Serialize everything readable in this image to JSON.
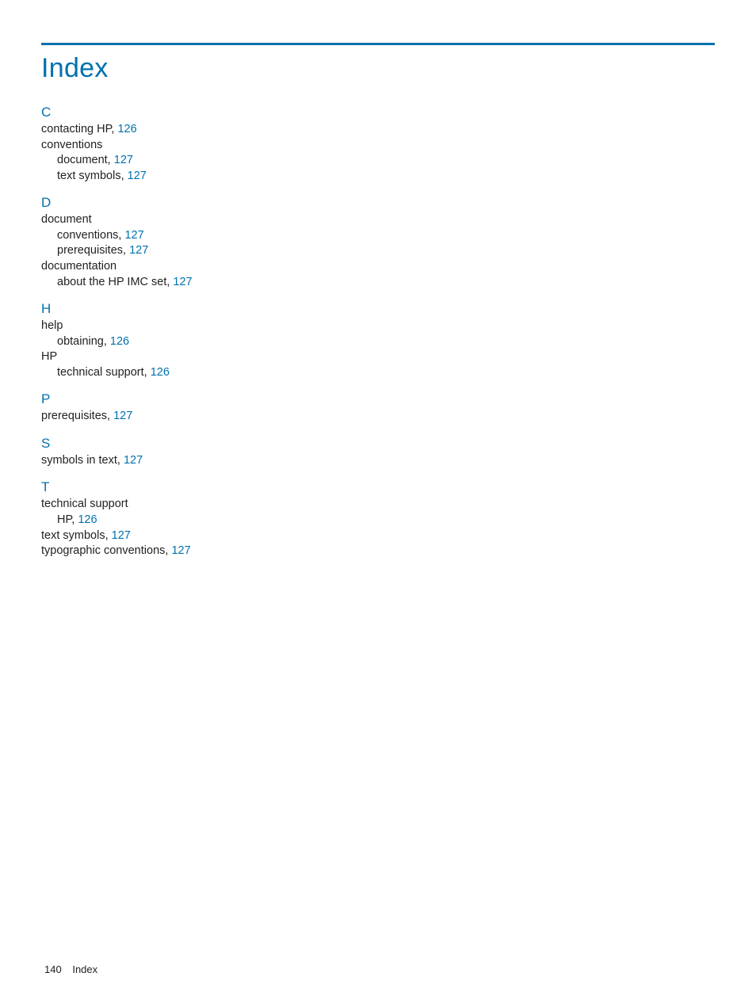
{
  "title": "Index",
  "sections": {
    "C": {
      "letter": "C",
      "e0_text": "contacting HP,",
      "e0_page": "126",
      "e1_text": "conventions",
      "e2_text": "document,",
      "e2_page": "127",
      "e3_text": "text symbols,",
      "e3_page": "127"
    },
    "D": {
      "letter": "D",
      "e0_text": "document",
      "e1_text": "conventions,",
      "e1_page": "127",
      "e2_text": "prerequisites,",
      "e2_page": "127",
      "e3_text": "documentation",
      "e4_text": "about the HP IMC set,",
      "e4_page": "127"
    },
    "H": {
      "letter": "H",
      "e0_text": "help",
      "e1_text": "obtaining,",
      "e1_page": "126",
      "e2_text": "HP",
      "e3_text": "technical support,",
      "e3_page": "126"
    },
    "P": {
      "letter": "P",
      "e0_text": "prerequisites,",
      "e0_page": "127"
    },
    "S": {
      "letter": "S",
      "e0_text": "symbols in text,",
      "e0_page": "127"
    },
    "T": {
      "letter": "T",
      "e0_text": "technical support",
      "e1_text": "HP,",
      "e1_page": "126",
      "e2_text": "text symbols,",
      "e2_page": "127",
      "e3_text": "typographic conventions,",
      "e3_page": "127"
    }
  },
  "footer": {
    "page_number": "140",
    "label": "Index"
  }
}
